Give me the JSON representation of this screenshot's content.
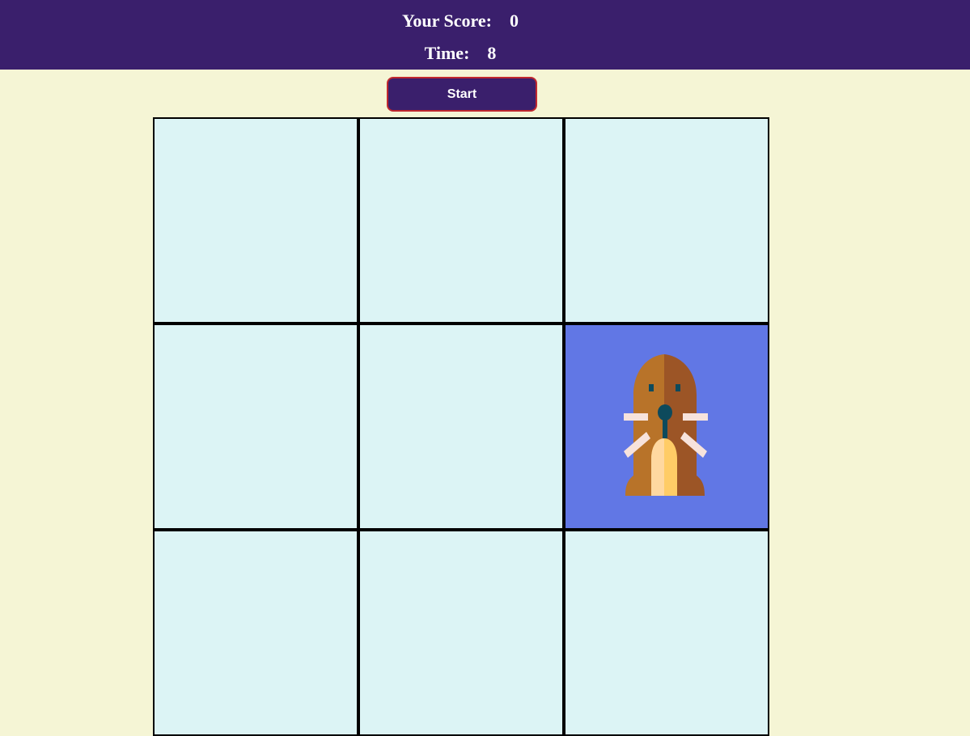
{
  "header": {
    "score_label": "Your Score:",
    "score_value": "0",
    "time_label": "Time:",
    "time_value": "8"
  },
  "controls": {
    "start_label": "Start"
  },
  "board": {
    "rows": 3,
    "columns": 3,
    "active_hole": 6,
    "character_icon": "walrus-icon"
  },
  "colors": {
    "header_bg": "#3a1f6c",
    "page_bg": "#f5f5d5",
    "hole_bg": "#dcf4f5",
    "active_hole_bg": "#6177e5",
    "button_border": "#c0282f"
  }
}
